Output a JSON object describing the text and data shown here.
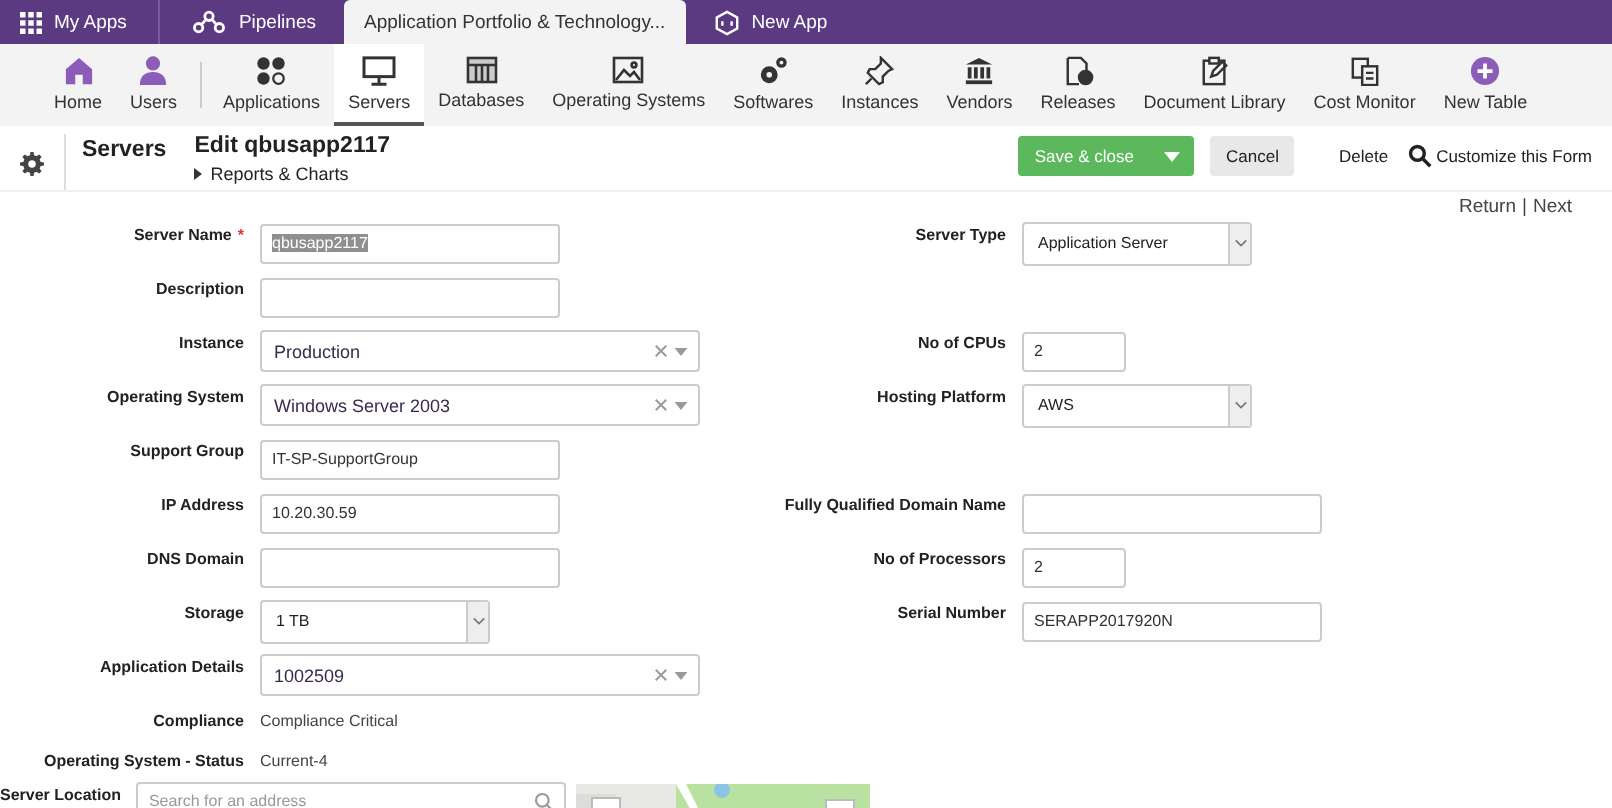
{
  "top_tabs": [
    {
      "label": "My Apps",
      "selected": false
    },
    {
      "label": "Pipelines",
      "selected": false
    },
    {
      "label": "Application Portfolio & Technology...",
      "selected": true
    },
    {
      "label": "New App",
      "selected": false
    }
  ],
  "toolbar": [
    {
      "label": "Home",
      "selected": false
    },
    {
      "label": "Users",
      "selected": false
    },
    {
      "label": "Applications",
      "selected": false
    },
    {
      "label": "Servers",
      "selected": true
    },
    {
      "label": "Databases",
      "selected": false
    },
    {
      "label": "Operating Systems",
      "selected": false
    },
    {
      "label": "Softwares",
      "selected": false
    },
    {
      "label": "Instances",
      "selected": false
    },
    {
      "label": "Vendors",
      "selected": false
    },
    {
      "label": "Releases",
      "selected": false
    },
    {
      "label": "Document Library",
      "selected": false
    },
    {
      "label": "Cost Monitor",
      "selected": false
    },
    {
      "label": "New Table",
      "selected": false
    }
  ],
  "header": {
    "section": "Servers",
    "title": "Edit qbusapp2117",
    "reports_link": "Reports & Charts",
    "save_button": "Save & close",
    "cancel_button": "Cancel",
    "delete_link": "Delete",
    "customize_link": "Customize this Form"
  },
  "pager": {
    "return_link": "Return",
    "separator": "|",
    "next_link": "Next"
  },
  "form_rows": [
    {
      "left": {
        "label": "Server Name",
        "required_mark": "*",
        "kind": "text",
        "value": "qbusapp2117",
        "highlighted": true
      },
      "right": {
        "label": "Server Type",
        "kind": "select",
        "value": "Application Server"
      }
    },
    {
      "left": {
        "label": "Description",
        "kind": "text"
      }
    },
    {
      "left": {
        "label": "Instance",
        "kind": "combo",
        "value": "Production"
      },
      "right": {
        "label": "No of CPUs",
        "kind": "number",
        "value": "2"
      }
    },
    {
      "left": {
        "label": "Operating System",
        "kind": "combo",
        "value": "Windows Server 2003"
      },
      "right": {
        "label": "Hosting Platform",
        "kind": "select",
        "value": "AWS"
      }
    },
    {
      "left": {
        "label": "Support Group",
        "kind": "text",
        "value": "IT-SP-SupportGroup"
      }
    },
    {
      "left": {
        "label": "IP Address",
        "kind": "text",
        "value": "10.20.30.59"
      },
      "right": {
        "label": "Fully Qualified Domain Name",
        "kind": "text"
      }
    },
    {
      "left": {
        "label": "DNS Domain",
        "kind": "text"
      },
      "right": {
        "label": "No of Processors",
        "kind": "number",
        "value": "2"
      }
    },
    {
      "left": {
        "label": "Storage",
        "kind": "select",
        "value": "1 TB"
      },
      "right": {
        "label": "Serial Number",
        "kind": "text",
        "value": "SERAPP2017920N"
      }
    },
    {
      "left": {
        "label": "Application Details",
        "kind": "combo",
        "value": "1002509"
      }
    },
    {
      "left": {
        "label": "Compliance",
        "kind": "static",
        "value": "Compliance Critical"
      }
    },
    {
      "left": {
        "label": "Operating System - Status",
        "kind": "static",
        "value": "Current-4"
      }
    },
    {
      "left": {
        "label": "Server Location",
        "kind": "address",
        "placeholder": "Search for an address"
      }
    }
  ]
}
